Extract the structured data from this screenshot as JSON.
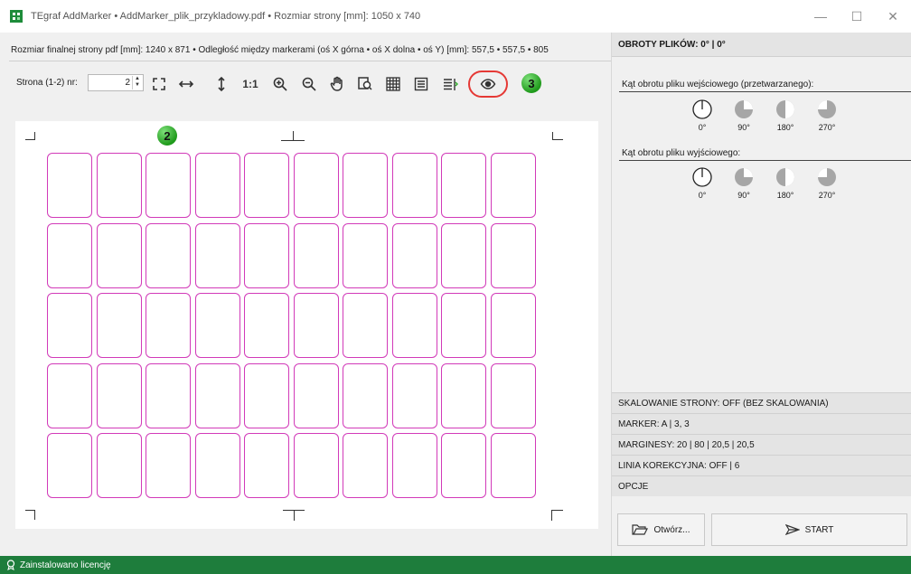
{
  "window": {
    "title": "TEgraf AddMarker • AddMarker_plik_przykladowy.pdf • Rozmiar strony [mm]: 1050 x 740",
    "controls": {
      "minimize": "—",
      "maximize": "☐",
      "close": "✕"
    }
  },
  "left": {
    "info_line": "Rozmiar finalnej strony pdf [mm]: 1240 x 871 • Odległość między markerami (oś X górna • oś X dolna • oś Y) [mm]: 557,5 • 557,5 • 805",
    "page_label": "Strona (1-2) nr:",
    "page_value": "2",
    "toolbar_icons": [
      "fit-page-icon",
      "fit-width-icon",
      "fit-height-icon",
      "actual-size-icon",
      "zoom-in-icon",
      "zoom-out-icon",
      "hand-icon",
      "zoom-area-icon",
      "grid-icon",
      "lines-icon",
      "text-lines-icon",
      "preview-eye-icon"
    ],
    "actual_size_label": "1:1",
    "badge_toolbar": "3",
    "badge_canvas": "2",
    "grid": {
      "rows": 5,
      "cols": 10,
      "cell_color": "#d23ab9"
    }
  },
  "right": {
    "header": "OBROTY PLIKÓW: 0° | 0°",
    "input_rotation_label": "Kąt obrotu pliku wejściowego (przetwarzanego):",
    "output_rotation_label": "Kąt obrotu pliku wyjściowego:",
    "angles": [
      "0°",
      "90°",
      "180°",
      "270°"
    ],
    "sections": [
      "SKALOWANIE STRONY: OFF (BEZ SKALOWANIA)",
      "MARKER: A | 3, 3",
      "MARGINESY: 20 | 80 | 20,5 | 20,5",
      "LINIA KOREKCYJNA: OFF | 6",
      "OPCJE"
    ],
    "open_button": "Otwórz...",
    "start_button": "START"
  },
  "status": {
    "text": "Zainstalowano licencję"
  },
  "colors": {
    "accent_green": "#1e7d3c",
    "highlight_red": "#e53935",
    "badge_green": "#2fae2a"
  }
}
